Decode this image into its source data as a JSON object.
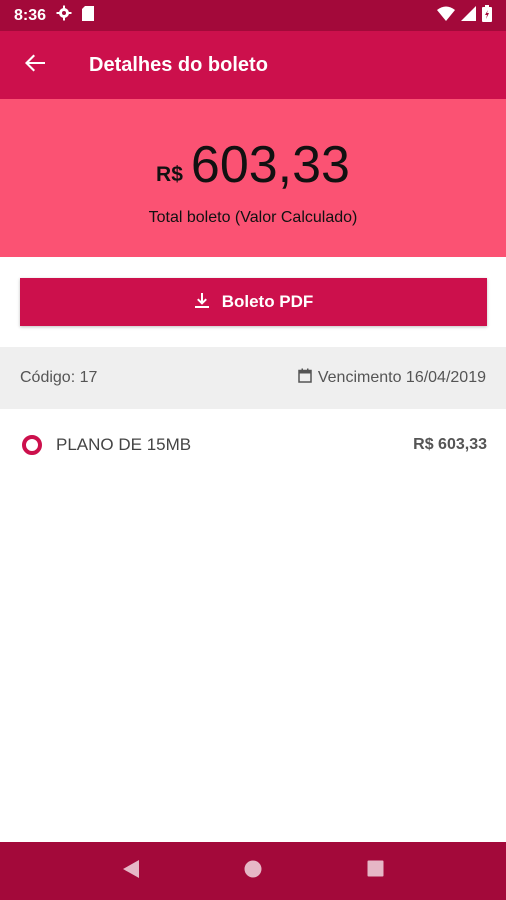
{
  "status_bar": {
    "time": "8:36",
    "icons": [
      "gear-icon",
      "sd-card-icon",
      "wifi-icon",
      "signal-icon",
      "battery-icon"
    ]
  },
  "app_bar": {
    "title": "Detalhes do boleto",
    "back_icon": "arrow-back-icon"
  },
  "summary": {
    "currency": "R$",
    "amount": "603,33",
    "label": "Total boleto (Valor Calculado)"
  },
  "pdf_button": {
    "label": "Boleto PDF",
    "icon": "download-icon"
  },
  "info": {
    "code": "Código: 17",
    "due_date": "Vencimento 16/04/2019",
    "due_icon": "calendar-icon"
  },
  "items": [
    {
      "name": "PLANO DE 15MB",
      "price": "R$ 603,33"
    }
  ],
  "colors": {
    "primary": "#cc104c",
    "primary_dark": "#a3093a",
    "hero": "#fb5273",
    "strip": "#efefef"
  },
  "nav": {
    "icons": [
      "back-triangle-icon",
      "home-circle-icon",
      "recents-square-icon"
    ]
  }
}
